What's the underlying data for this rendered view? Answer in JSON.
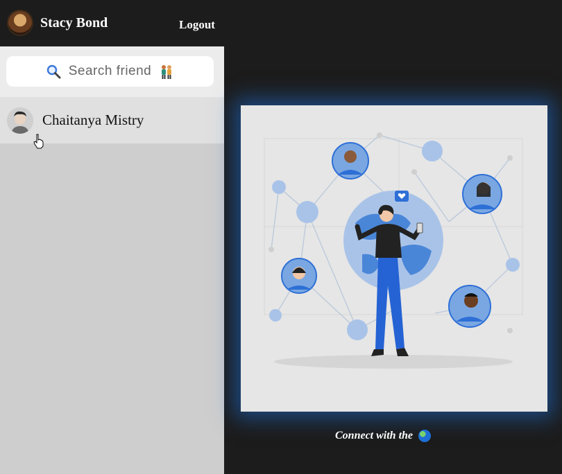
{
  "header": {
    "user_name": "Stacy Bond",
    "logout_label": "Logout"
  },
  "search": {
    "placeholder": "Search friend"
  },
  "friends": [
    {
      "name": "Chaitanya Mistry"
    }
  ],
  "main": {
    "caption": "Connect with the"
  },
  "icons": {
    "search": "magnifier-icon",
    "friends": "two-people-icon",
    "globe": "globe-icon",
    "cursor": "hand-pointer-icon"
  },
  "colors": {
    "accent_blue": "#1e6ed2",
    "header_bg": "#1c1c1c"
  }
}
